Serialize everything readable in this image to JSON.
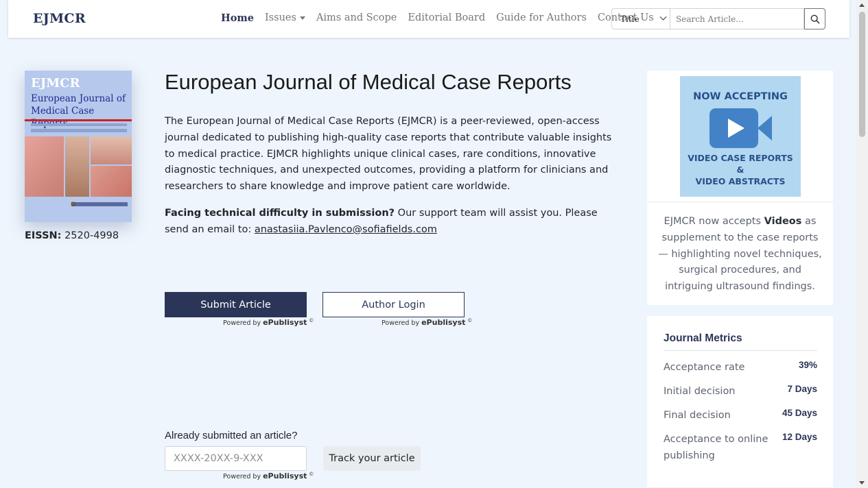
{
  "brand": "EJMCR",
  "nav": {
    "home": "Home",
    "issues": "Issues",
    "aims": "Aims and Scope",
    "board": "Editorial Board",
    "guide": "Guide for Authors",
    "contact": "Contact Us"
  },
  "search": {
    "select_value": "Title",
    "placeholder": "Search Article..."
  },
  "cover": {
    "abbr": "EJMCR",
    "title": "European Journal of Medical Case Reports"
  },
  "eissn": {
    "label": "EISSN:",
    "value": "2520-4998"
  },
  "main": {
    "title": "European Journal of Medical Case Reports",
    "description": "The European Journal of Medical Case Reports (EJMCR) is a peer-reviewed, open-access journal dedicated to publishing high-quality case reports that contribute valuable insights to medical practice. EJMCR highlights unique clinical cases, rare conditions, innovative diagnostic techniques, and unexpected outcomes, providing a platform for clinicians and researchers to share knowledge and improve patient care worldwide.",
    "support_bold": "Facing technical difficulty in submission?",
    "support_text": " Our support team will assist you. Please send an email to: ",
    "support_email": "anastasiia.Pavlenco@sofiafields.com"
  },
  "buttons": {
    "submit": "Submit Article",
    "login": "Author Login",
    "powered_prefix": "Powered by ",
    "powered_brand": "ePublisyst",
    "powered_mark": "©"
  },
  "track": {
    "question": "Already submitted an article?",
    "placeholder": "XXXX-20XX-9-XXX",
    "button": "Track your article"
  },
  "video_panel": {
    "banner_top": "NOW ACCEPTING",
    "banner_line1": "VIDEO CASE REPORTS",
    "banner_line2": "&",
    "banner_line3": "VIDEO ABSTRACTS",
    "text_pre": "EJMCR now accepts ",
    "text_bold": "Videos",
    "text_post": " as supplement to the case reports — highlighting novel techniques, surgical procedures, and intriguing ultrasound findings."
  },
  "metrics": {
    "title": "Journal Metrics",
    "rows": [
      {
        "label": "Acceptance rate",
        "value": "39%"
      },
      {
        "label": "Initial decision",
        "value": "7 Days"
      },
      {
        "label": "Final decision",
        "value": "45 Days"
      },
      {
        "label": "Acceptance to online publishing",
        "value": "12 Days"
      }
    ]
  },
  "colors": {
    "brand": "#2a3558",
    "background": "#eef5fc",
    "banner": "#b2d7f0",
    "banner_accent": "#4382c6"
  },
  "icons": [
    "search-icon",
    "video-camera-icon",
    "chevron-down-icon",
    "caret-down-icon"
  ]
}
